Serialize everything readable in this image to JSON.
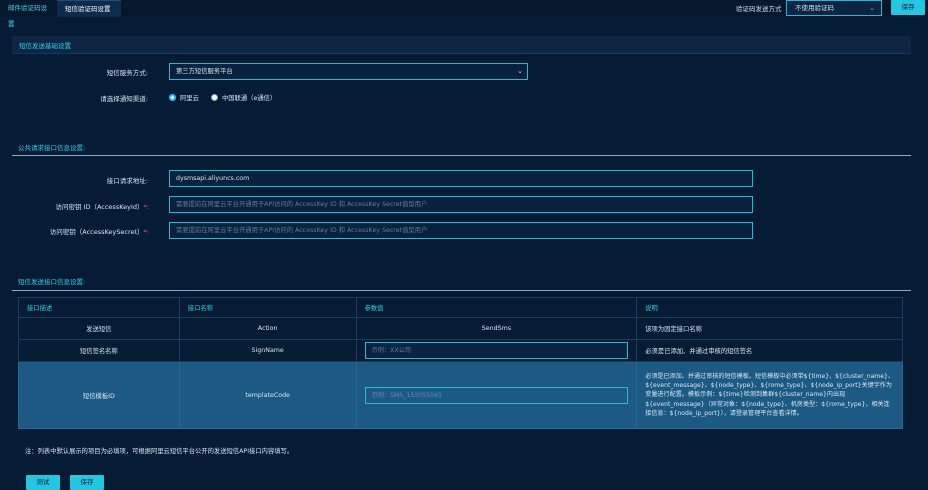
{
  "tabs": [
    {
      "label": "邮件验证码设置"
    },
    {
      "label": "短信验证码设置"
    }
  ],
  "top": {
    "mode_label": "验证码发送方式",
    "mode_value": "不使用验证码",
    "save_label": "保存"
  },
  "basic": {
    "title": "短信发送基础设置",
    "service_label": "短信服务方式:",
    "service_value": "第三方短信服务平台",
    "channel_label": "请选择通知渠道:",
    "channel_options": [
      {
        "label": "阿里云",
        "selected": true
      },
      {
        "label": "中国联通（e通信）",
        "selected": false
      }
    ]
  },
  "public": {
    "title": "公共请求接口信息设置:",
    "url_label": "接口请求地址:",
    "url_value": "dysmsapi.aliyuncs.com",
    "keyid_label": "访问密钥 ID（AccessKeyId）",
    "keyid_placeholder": "需要提前在阿里云平台开通用于API访问的 AccessKey ID 和 AccessKey Secret值型用户",
    "secret_label": "访问密钥（AccessKeySecret）",
    "secret_placeholder": "需要提前在阿里云平台开通用于API访问的 AccessKey ID 和 AccessKey Secret值型用户",
    "required_mark": "*:"
  },
  "interface": {
    "title": "短信发送接口信息设置:",
    "headers": [
      "接口描述",
      "接口名称",
      "参数值",
      "说明"
    ],
    "rows": [
      {
        "desc": "发送短信",
        "name": "Action",
        "value": "SendSms",
        "note": "该项为固定接口名称"
      },
      {
        "desc": "短信签名名称",
        "name": "SignName",
        "placeholder": "示例：XX公司",
        "note": "必须是已添加、并通过审核的短信签名"
      },
      {
        "desc": "短信模板ID",
        "name": "templateCode",
        "placeholder": "示例：SMS_153055065",
        "note": "必须是已添加、并通过审核的短信模板。短信模板中必须带${time}、${cluster_name}、${event_message}、${node_type}、${rome_type}、${node_ip_port}关键字作为变量进行配置。模板示例：${time}检测到集群${cluster_name}内出现${event_message}（异常对象：${node_type}、机房类型：${rome_type}，相关连接信息：${node_ip_port}），请登录管理平台查看详情。"
      }
    ]
  },
  "footer": {
    "note": "注：列表中默认展示的项目为必填项，可根据阿里云短信平台公开的发送短信API接口内容填写。",
    "test_label": "测试",
    "save_label": "保存"
  }
}
